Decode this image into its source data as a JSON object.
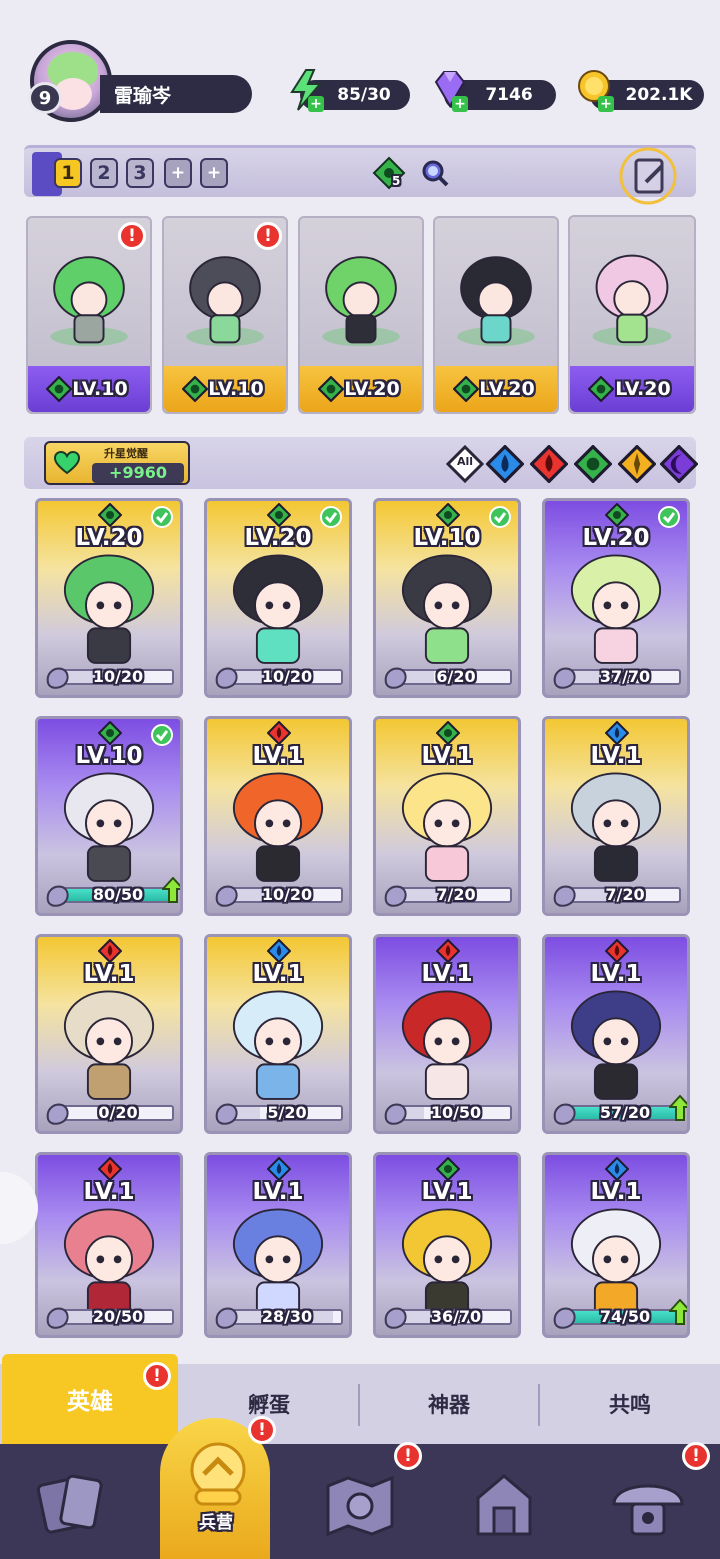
{
  "player": {
    "level": "9",
    "name": "雷瑜岑"
  },
  "resources": {
    "energy": "85/30",
    "gems": "7146",
    "gold": "202.1K"
  },
  "team_slots": [
    "1",
    "2",
    "3"
  ],
  "team_bar": {
    "nature_count": "5"
  },
  "team": [
    {
      "level": "LV.10",
      "foot": "purple",
      "alert": "!"
    },
    {
      "level": "LV.10",
      "foot": "gold",
      "alert": "!"
    },
    {
      "level": "LV.20",
      "foot": "gold"
    },
    {
      "level": "LV.20",
      "foot": "gold"
    },
    {
      "level": "LV.20",
      "foot": "purple"
    }
  ],
  "awaken": {
    "label": "升星觉醒",
    "value": "+9960"
  },
  "filters": [
    "All",
    "water",
    "fire",
    "nature",
    "light",
    "dark"
  ],
  "heroes": [
    {
      "level": "LV.20",
      "progress": "10/20",
      "element": "nature",
      "tier": "gold",
      "checked": true,
      "fill": 0.5
    },
    {
      "level": "LV.20",
      "progress": "10/20",
      "element": "nature",
      "tier": "gold",
      "checked": true,
      "fill": 0.5
    },
    {
      "level": "LV.10",
      "progress": "6/20",
      "element": "nature",
      "tier": "gold",
      "checked": true,
      "fill": 0.3
    },
    {
      "level": "LV.20",
      "progress": "37/70",
      "element": "nature",
      "tier": "purple",
      "checked": true,
      "fill": 0.53
    },
    {
      "level": "LV.10",
      "progress": "80/50",
      "element": "nature",
      "tier": "purple",
      "checked": true,
      "fill": 1,
      "upgrade": true
    },
    {
      "level": "LV.1",
      "progress": "10/20",
      "element": "fire",
      "tier": "gold",
      "fill": 0.5
    },
    {
      "level": "LV.1",
      "progress": "7/20",
      "element": "nature",
      "tier": "gold",
      "fill": 0.35
    },
    {
      "level": "LV.1",
      "progress": "7/20",
      "element": "water",
      "tier": "gold",
      "fill": 0.35
    },
    {
      "level": "LV.1",
      "progress": "0/20",
      "element": "fire",
      "tier": "gold",
      "fill": 0
    },
    {
      "level": "LV.1",
      "progress": "5/20",
      "element": "water",
      "tier": "gold",
      "fill": 0.25
    },
    {
      "level": "LV.1",
      "progress": "10/50",
      "element": "fire",
      "tier": "purple",
      "fill": 0.2
    },
    {
      "level": "LV.1",
      "progress": "57/20",
      "element": "fire",
      "tier": "purple",
      "fill": 1,
      "upgrade": true
    },
    {
      "level": "LV.1",
      "progress": "20/50",
      "element": "fire",
      "tier": "purple",
      "fill": 0.4
    },
    {
      "level": "LV.1",
      "progress": "28/30",
      "element": "water",
      "tier": "purple",
      "fill": 0.93
    },
    {
      "level": "LV.1",
      "progress": "36/70",
      "element": "nature",
      "tier": "purple",
      "fill": 0.51
    },
    {
      "level": "LV.1",
      "progress": "74/50",
      "element": "water",
      "tier": "purple",
      "fill": 1,
      "upgrade": true
    }
  ],
  "tabs": [
    "英雄",
    "孵蛋",
    "神器",
    "共鸣"
  ],
  "nav": {
    "active_label": "兵营"
  },
  "colors": {
    "gold": "#f7c823",
    "purple": "#7d4de2",
    "nature": "#36b24a",
    "fire": "#e8332f",
    "water": "#2a8be8"
  }
}
